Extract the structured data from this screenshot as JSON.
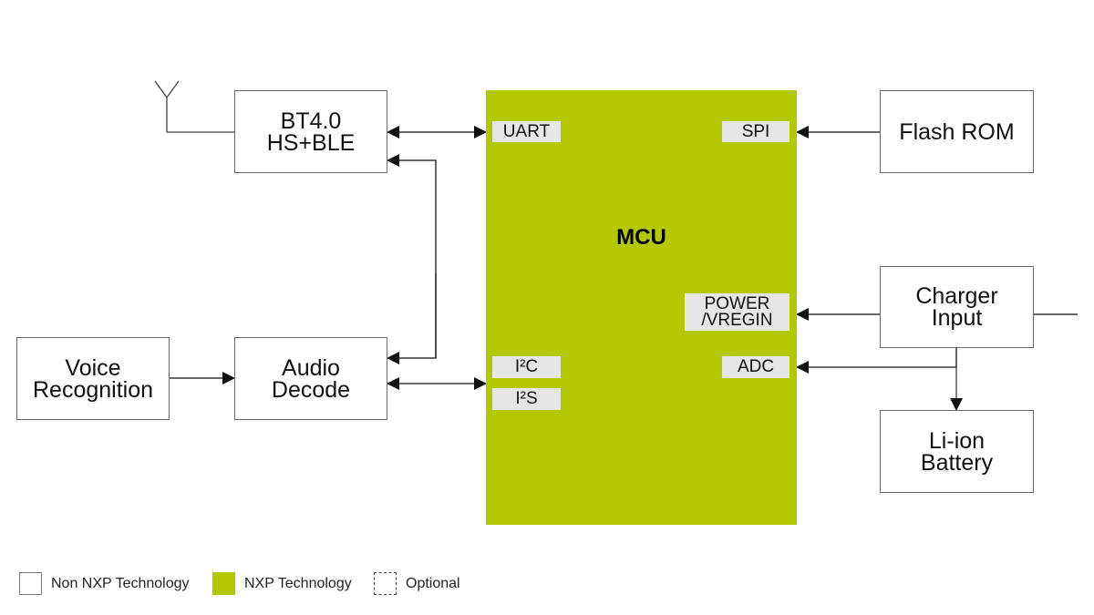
{
  "diagram": {
    "blocks": {
      "bt": {
        "line1": "BT4.0",
        "line2": "HS+BLE"
      },
      "voice": {
        "line1": "Voice",
        "line2": "Recognition"
      },
      "audio": {
        "line1": "Audio",
        "line2": "Decode"
      },
      "flash": {
        "line1": "Flash ROM"
      },
      "charger": {
        "line1": "Charger",
        "line2": "Input"
      },
      "battery": {
        "line1": "Li-ion",
        "line2": "Battery"
      }
    },
    "mcu": {
      "title": "MCU",
      "ports": {
        "uart": "UART",
        "spi": "SPI",
        "power_line1": "POWER",
        "power_line2": "/VREGIN",
        "adc": "ADC",
        "i2c": "I²C",
        "i2s": "I²S"
      }
    },
    "colors": {
      "nxp_green": "#b2c900",
      "port_gray": "#e6e6e6",
      "line": "#111111"
    }
  },
  "legend": {
    "non_nxp": "Non NXP Technology",
    "nxp": "NXP Technology",
    "optional": "Optional"
  }
}
